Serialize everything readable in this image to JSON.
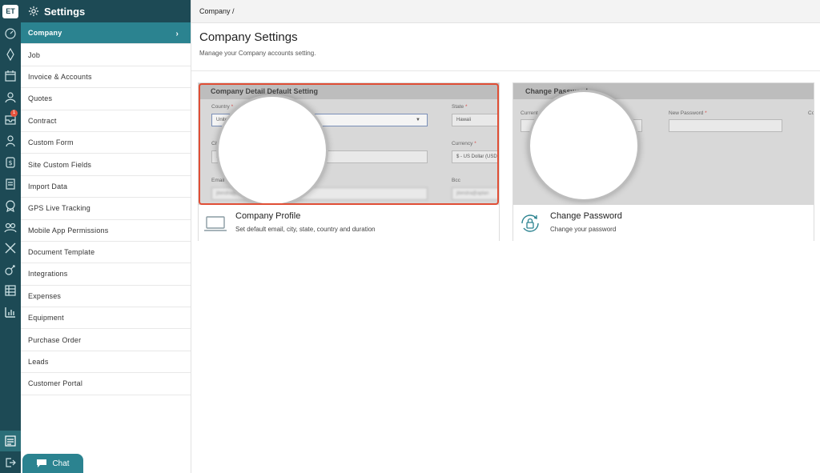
{
  "rail": {
    "logo": "ET",
    "icons": [
      "dashboard-icon",
      "job-icon",
      "calendar-icon",
      "users-icon",
      "inbox-icon",
      "person-icon",
      "dollar-icon",
      "document-icon",
      "list-icon",
      "badge-icon",
      "team-icon",
      "tools-icon",
      "tracking-icon",
      "report-icon",
      "chart-icon",
      "settings-panel-icon",
      "logout-icon"
    ],
    "badge": "1"
  },
  "sidebar": {
    "title": "Settings",
    "items": [
      {
        "label": "Company",
        "active": true
      },
      {
        "label": "Job"
      },
      {
        "label": "Invoice & Accounts"
      },
      {
        "label": "Quotes"
      },
      {
        "label": "Contract"
      },
      {
        "label": "Custom Form"
      },
      {
        "label": "Site Custom Fields"
      },
      {
        "label": "Import Data"
      },
      {
        "label": "GPS Live Tracking"
      },
      {
        "label": "Mobile App Permissions"
      },
      {
        "label": "Document Template"
      },
      {
        "label": "Integrations"
      },
      {
        "label": "Expenses"
      },
      {
        "label": "Equipment"
      },
      {
        "label": "Purchase Order"
      },
      {
        "label": "Leads"
      },
      {
        "label": "Customer Portal"
      }
    ],
    "chevron": "›"
  },
  "chat": {
    "label": "Chat"
  },
  "header": {
    "breadcrumb": "Company /",
    "title": "Company Settings",
    "subtitle": "Manage your Company accounts setting."
  },
  "cards": [
    {
      "preview_title": "Company Detail Default Setting",
      "fields": {
        "country_label": "Country",
        "country_value": "United States",
        "state_label": "State",
        "state_value": "Hawaii",
        "city_label": "City",
        "city_value": "Hawaii city",
        "currency_label": "Currency",
        "currency_value": "$ - US Dollar (USD)",
        "email_label": "Email",
        "email_value": "jitendra@aplancefs.com",
        "bcc_label": "Bcc",
        "bcc_value": "jitendra@aplan"
      },
      "title": "Company Profile",
      "description": "Set default email, city, state, country and duration",
      "icon": "laptop-icon"
    },
    {
      "preview_title": "Change Password",
      "fields": {
        "current_label": "Current Password",
        "new_label": "New Password",
        "confirm_label": "Co"
      },
      "title": "Change Password",
      "description": "Change your password",
      "icon": "lock-refresh-icon"
    }
  ],
  "colors": {
    "rail": "#1d4a55",
    "active": "#2b8390",
    "highlight": "#e04e35",
    "required": "#d9534f"
  }
}
